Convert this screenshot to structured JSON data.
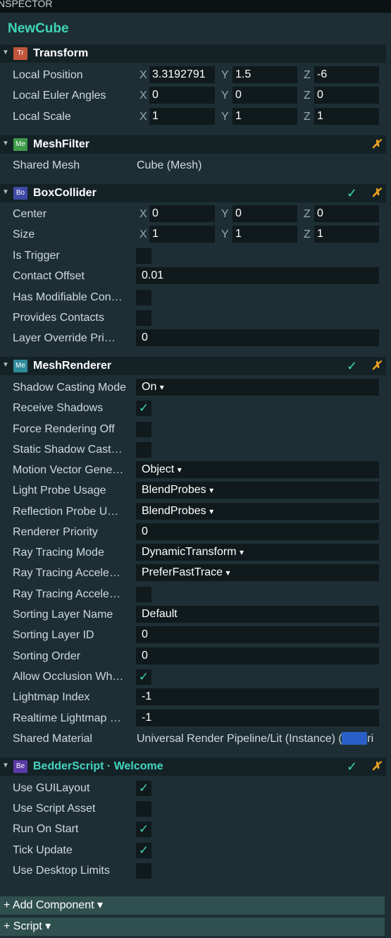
{
  "panel": {
    "title": "NSPECTOR",
    "object_name": "NewCube"
  },
  "components": {
    "transform": {
      "badge": "Tr",
      "badge_color": "#c2553c",
      "title": "Transform",
      "rows": [
        {
          "label": "Local Position",
          "x": "3.3192791",
          "y": "1.5",
          "z": "-6"
        },
        {
          "label": "Local Euler Angles",
          "x": "0",
          "y": "0",
          "z": "0"
        },
        {
          "label": "Local Scale",
          "x": "1",
          "y": "1",
          "z": "1"
        }
      ]
    },
    "meshfilter": {
      "badge": "Me",
      "badge_color": "#3e9a4a",
      "title": "MeshFilter",
      "remove": "✗",
      "shared_mesh_label": "Shared Mesh",
      "shared_mesh_value": "Cube  (Mesh)"
    },
    "boxcollider": {
      "badge": "Bo",
      "badge_color": "#3f4aa6",
      "title": "BoxCollider",
      "enabled": "✓",
      "remove": "✗",
      "center": {
        "label": "Center",
        "x": "0",
        "y": "0",
        "z": "0"
      },
      "size": {
        "label": "Size",
        "x": "1",
        "y": "1",
        "z": "1"
      },
      "is_trigger": "Is Trigger",
      "contact_offset_label": "Contact Offset",
      "contact_offset": "0.01",
      "has_modifiable": "Has Modifiable Con…",
      "provides_contacts": "Provides Contacts",
      "layer_override_label": "Layer Override Pri…",
      "layer_override": "0"
    },
    "meshrenderer": {
      "badge": "Me",
      "badge_color": "#2f8a9a",
      "title": "MeshRenderer",
      "enabled": "✓",
      "remove": "✗",
      "shadow_casting_label": "Shadow Casting Mode",
      "shadow_casting": "On",
      "receive_shadows_label": "Receive Shadows",
      "receive_shadows": "✓",
      "force_off_label": "Force Rendering Off",
      "static_shadow_label": "Static Shadow Cast…",
      "motion_vector_label": "Motion Vector Gene…",
      "motion_vector": "Object",
      "light_probe_label": "Light Probe Usage",
      "light_probe": "BlendProbes",
      "reflection_probe_label": "Reflection Probe U…",
      "reflection_probe": "BlendProbes",
      "renderer_priority_label": "Renderer Priority",
      "renderer_priority": "0",
      "ray_mode_label": "Ray Tracing Mode",
      "ray_mode": "DynamicTransform",
      "ray_accel1_label": "Ray Tracing Accele…",
      "ray_accel1": "PreferFastTrace",
      "ray_accel2_label": "Ray Tracing Accele…",
      "sorting_layer_name_label": "Sorting Layer Name",
      "sorting_layer_name": "Default",
      "sorting_layer_id_label": "Sorting Layer ID",
      "sorting_layer_id": "0",
      "sorting_order_label": "Sorting Order",
      "sorting_order": "0",
      "allow_occlusion_label": "Allow Occlusion Wh…",
      "allow_occlusion": "✓",
      "lightmap_index_label": "Lightmap Index",
      "lightmap_index": "-1",
      "realtime_lightmap_label": "Realtime Lightmap …",
      "realtime_lightmap": "-1",
      "shared_material_label": "Shared Material",
      "shared_material": "Universal Render Pipeline/Lit (Instance)  (Materi"
    },
    "bedderscript": {
      "badge": "Be",
      "badge_color": "#5a3aa6",
      "title": "BedderScript · Welcome",
      "enabled": "✓",
      "remove": "✗",
      "use_guilayout": {
        "label": "Use GUILayout",
        "value": "✓"
      },
      "use_script_asset": {
        "label": "Use Script Asset",
        "value": ""
      },
      "run_on_start": {
        "label": "Run On Start",
        "value": "✓"
      },
      "tick_update": {
        "label": "Tick Update",
        "value": "✓"
      },
      "use_desktop_limits": {
        "label": "Use Desktop Limits",
        "value": ""
      }
    }
  },
  "axes": {
    "x": "X",
    "y": "Y",
    "z": "Z"
  },
  "dropdown_arrow": "▾",
  "footer": {
    "add_component": "+ Add Component ▾",
    "script": "+ Script ▾"
  }
}
